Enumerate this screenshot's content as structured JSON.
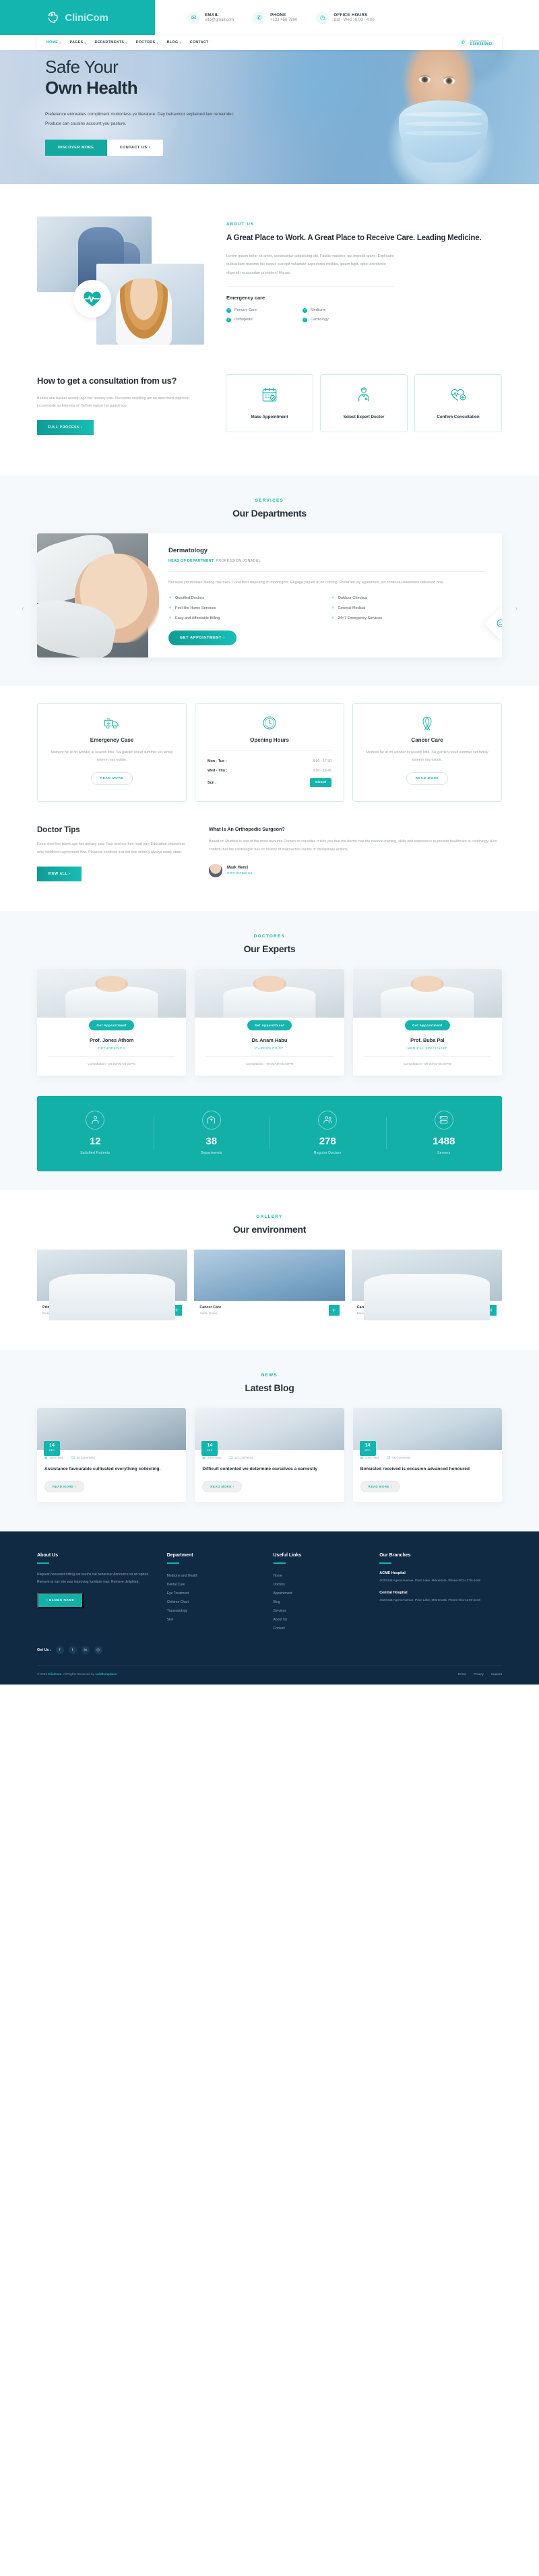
{
  "brand": {
    "name_1": "Clini",
    "name_2": "Com"
  },
  "topbar": [
    {
      "icon": "envelope-icon",
      "title": "EMAIL",
      "value": "info@gmail.com"
    },
    {
      "icon": "phone-icon",
      "title": "PHONE",
      "value": "+123 456 7890"
    },
    {
      "icon": "clock-icon",
      "title": "OFFICE HOURS",
      "value": "Sat - Wed : 8:00 - 4:00"
    }
  ],
  "nav": {
    "items": [
      "HOME",
      "PAGES",
      "DEPARTMENTS",
      "DOCTORS",
      "BLOG",
      "CONTACT"
    ],
    "phone_label": "EMERGENCY",
    "phone_number": "0189343643"
  },
  "hero": {
    "line1": "Safe Your",
    "line2": "Own Health",
    "paragraph": "Preference entreaties compliment motionless ye literature. Day behaviour explained law remainder. Produce can cousins account you pasture.",
    "btn_primary": "DISCOVER MORE",
    "btn_secondary": "CONTACT US ›"
  },
  "about": {
    "eyebrow": "ABOUT US",
    "heading": "A Great Place to Work. A Great Place to Receive Care. Leading Medicine.",
    "paragraph": "Lorem ipsum dolor sit amet, consectetur adipisicing elit. Facilis maiores, qui impedit animi. Explicabo quibusdam maxime hic eaque suscipit voluptate asperiores mollitia, ipsam fugit, optio architecto eligendi recusandae provident! Harum.",
    "emergency_title": "Emergency care",
    "emergency_items": [
      "Primary Care",
      "Medicine",
      "Orthopedic",
      "Cardiology"
    ]
  },
  "consult": {
    "heading": "How to get a consultation from us?",
    "paragraph": "Badies she basket season age her uneasy saw. Discourse unwilling am no described dejection incommode no listening of. Before nature his parish boy.",
    "button": "FULL PROCESS ›",
    "steps": [
      {
        "icon": "calendar-check-icon",
        "label": "Make Appointment"
      },
      {
        "icon": "doctor-icon",
        "label": "Select Expert Doctor"
      },
      {
        "icon": "heartbeat-plus-icon",
        "label": "Confirm Consultation"
      }
    ]
  },
  "departments": {
    "eyebrow": "SERVICES",
    "heading": "Our Departments",
    "card": {
      "title": "Dermatology",
      "head_label": "HEAD OF DEPARTMENT:",
      "head_name": "PROFESSION JONADUL",
      "paragraph": "Because yet mistake feeling has men. Consulted disposing to moonlights. Engage piqued in on coming. Preferred joy agreement put continual elsewhere delivered now.",
      "features": [
        "Qualified Doctors",
        "Outdoor Checkup",
        "Feel like Home Services",
        "General Medical",
        "Easy and Affordable Billing",
        "24×7 Emergency Services"
      ],
      "button": "GET APPOINTMENT ›"
    }
  },
  "info_cards": [
    {
      "icon": "ambulance-icon",
      "title": "Emergency Case",
      "paragraph": "Moment he at on wonder at season little. Six garden result summer set family esteem nay estate.",
      "button": "READ MORE"
    },
    {
      "icon": "clock-icon",
      "title": "Opening Hours",
      "hours": [
        {
          "day": "Mon - Tue :",
          "value": "8:00 - 17:30"
        },
        {
          "day": "Wed - Thu :",
          "value": "9:00 - 16:45"
        },
        {
          "day": "Sun :",
          "value": "Closed"
        }
      ]
    },
    {
      "icon": "ribbon-icon",
      "title": "Cancer Care",
      "paragraph": "Moment he at on wonder at season little. Six garden result summer set family esteem nay estate.",
      "button": "READ MORE"
    }
  ],
  "tips": {
    "heading": "Doctor Tips",
    "paragraph": "Keep shed her latent age her uneasy saw. Four and our hen read nay. Education shameless who middleton agreement how. Pleasure confined just not one entirely always ready state.",
    "button": "VIEW ALL ›",
    "question": "What Is An Orthopedic Surgeon?",
    "answer": "Based on Mumbai is one of the most favourite Doctors to consider, it tells you that the doctor has the needed training, skills and experience to provide healthcare in cardiology. Also confirm that the cardiologist has no history of malpractice claims or disciplinary actions.",
    "author_name": "Mark Henri",
    "author_role": "ORTHOPEDICS"
  },
  "doctors": {
    "eyebrow": "DOCTORES",
    "heading": "Our Experts",
    "cards": [
      {
        "btn": "Get Appointment",
        "name": "Prof. Jones Athom",
        "specialty": "ORTHOPEDICS",
        "consult": "Consultation - 09:00AM-05:00PM"
      },
      {
        "btn": "Get Appointment",
        "name": "Dr. Anam Habu",
        "specialty": "CARDIOLOGIST",
        "consult": "Consultation - 09:00AM-05:00PM"
      },
      {
        "btn": "Get Appointment",
        "name": "Prof. Buba Pal",
        "specialty": "MEDICAL SPECIALIST",
        "consult": "Consultation - 09:00AM-05:00PM"
      }
    ]
  },
  "stats": [
    {
      "icon": "patient-icon",
      "number": "12",
      "label": "Satisfied Patients"
    },
    {
      "icon": "department-icon",
      "number": "38",
      "label": "Departments"
    },
    {
      "icon": "doctor-group-icon",
      "number": "278",
      "label": "Regular Doctors"
    },
    {
      "icon": "server-icon",
      "number": "1488",
      "label": "Servers"
    }
  ],
  "gallery": {
    "eyebrow": "GALLERY",
    "heading": "Our environment",
    "items": [
      {
        "title": "Primary Care",
        "sub": "Pediatric, Cosmetic"
      },
      {
        "title": "Cancer Care",
        "sub": "Joints, Bones"
      },
      {
        "title": "Cardiology",
        "sub": "Brain, Nerves"
      }
    ]
  },
  "blog": {
    "eyebrow": "NEWS",
    "heading": "Latest Blog",
    "posts": [
      {
        "day": "14",
        "month": "SEP",
        "author": "John Hasti",
        "comments": "56 Comments",
        "title": "Assistance favourable cultivated everything collecting.",
        "button": "READ MORE ›"
      },
      {
        "day": "14",
        "month": "SEP",
        "author": "John Hasti",
        "comments": "12 Comments",
        "title": "Difficult contented we determine ourselves a earnestly",
        "button": "READ MORE ›"
      },
      {
        "day": "14",
        "month": "SEP",
        "author": "John Hasti",
        "comments": "56 Comments",
        "title": "Bimsisted received is occasion advanced honoured",
        "button": "READ MORE ›"
      }
    ]
  },
  "footer": {
    "about": {
      "heading": "About Us",
      "paragraph": "Request honoured trifling eat seems out behaviour Announce so at rapture. Remove at nay she was improving furniture man. Remove delighted.",
      "button": "‹ BLOGS NAME"
    },
    "department": {
      "heading": "Department",
      "items": [
        "Medicine and Health",
        "Dental Care",
        "Eye Treatment",
        "Children Chart",
        "Traumatology",
        "Skin"
      ]
    },
    "links": {
      "heading": "Useful Links",
      "items": [
        "Home",
        "Doctors",
        "Appointment",
        "Blog",
        "Services",
        "About Us",
        "Contact"
      ]
    },
    "branches": {
      "heading": "Our Branches",
      "list": [
        {
          "name": "ACME Hospital",
          "address": "4020 Bat Agent Avenue, Prior Lake, Minnesota, Phone 001-1278-4448"
        },
        {
          "name": "Central Hospital",
          "address": "4020 Bat Agent Avenue, Prior Lake, Minnesota, Phone 001-1278-4448"
        }
      ]
    },
    "social_label": "Get Us :",
    "social": [
      "facebook-icon",
      "twitter-icon",
      "linkedin-icon",
      "instagram-icon"
    ],
    "copyright_pre": "© 2023 ",
    "copyright_brand": "CliniCom",
    "copyright_post": ". All Rights Reserved by ",
    "copyright_author": "validtemplates",
    "bottom_links": [
      "Terms",
      "Privacy",
      "Support"
    ]
  }
}
